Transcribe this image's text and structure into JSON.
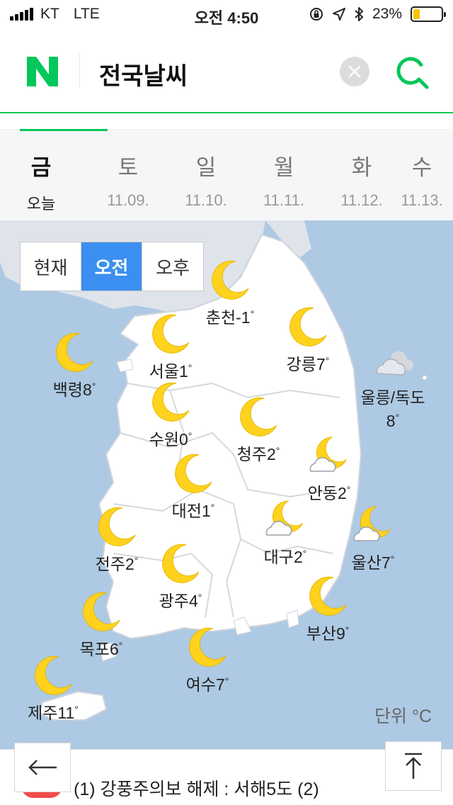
{
  "status_bar": {
    "carrier": "KT",
    "network": "LTE",
    "time": "오전 4:50",
    "battery": "23%",
    "battery_level": 0.23,
    "icons": [
      "orientation-lock-icon",
      "location-icon",
      "bluetooth-icon"
    ]
  },
  "header": {
    "logo": "N",
    "title": "전국날씨",
    "clear_icon": "close-icon",
    "search_icon": "search-icon",
    "accent": "#03c75a"
  },
  "days": [
    {
      "weekday": "금",
      "date": "오늘",
      "active": true
    },
    {
      "weekday": "토",
      "date": "11.09."
    },
    {
      "weekday": "일",
      "date": "11.10."
    },
    {
      "weekday": "월",
      "date": "11.11."
    },
    {
      "weekday": "화",
      "date": "11.12."
    },
    {
      "weekday": "수",
      "date": "11.13."
    }
  ],
  "time_toggle": {
    "options": [
      "현재",
      "오전",
      "오후"
    ],
    "selected": "오전",
    "selected_color": "#3a8ff0"
  },
  "cities": [
    {
      "name": "춘천",
      "temp": "-1",
      "weather": "moon"
    },
    {
      "name": "서울",
      "temp": "1",
      "weather": "moon"
    },
    {
      "name": "강릉",
      "temp": "7",
      "weather": "moon"
    },
    {
      "name": "백령",
      "temp": "8",
      "weather": "moon"
    },
    {
      "name": "울릉/독도",
      "temp": "8",
      "weather": "cloud"
    },
    {
      "name": "수원",
      "temp": "0",
      "weather": "moon"
    },
    {
      "name": "청주",
      "temp": "2",
      "weather": "moon"
    },
    {
      "name": "안동",
      "temp": "2",
      "weather": "moon-cloud"
    },
    {
      "name": "대전",
      "temp": "1",
      "weather": "moon"
    },
    {
      "name": "대구",
      "temp": "2",
      "weather": "moon-cloud"
    },
    {
      "name": "울산",
      "temp": "7",
      "weather": "moon-cloud"
    },
    {
      "name": "전주",
      "temp": "2",
      "weather": "moon"
    },
    {
      "name": "광주",
      "temp": "4",
      "weather": "moon"
    },
    {
      "name": "부산",
      "temp": "9",
      "weather": "moon"
    },
    {
      "name": "목포",
      "temp": "6",
      "weather": "moon"
    },
    {
      "name": "여수",
      "temp": "7",
      "weather": "moon"
    },
    {
      "name": "제주",
      "temp": "11",
      "weather": "moon"
    }
  ],
  "degree_symbol": "°",
  "unit_label": "단위 °C",
  "ticker": {
    "text": "(1) 강풍주의보 해제 : 서해5도 (2)",
    "badge_color": "#f24b4b"
  },
  "buttons": {
    "back_icon": "arrow-left-icon",
    "top_icon": "arrow-up-to-top-icon"
  }
}
